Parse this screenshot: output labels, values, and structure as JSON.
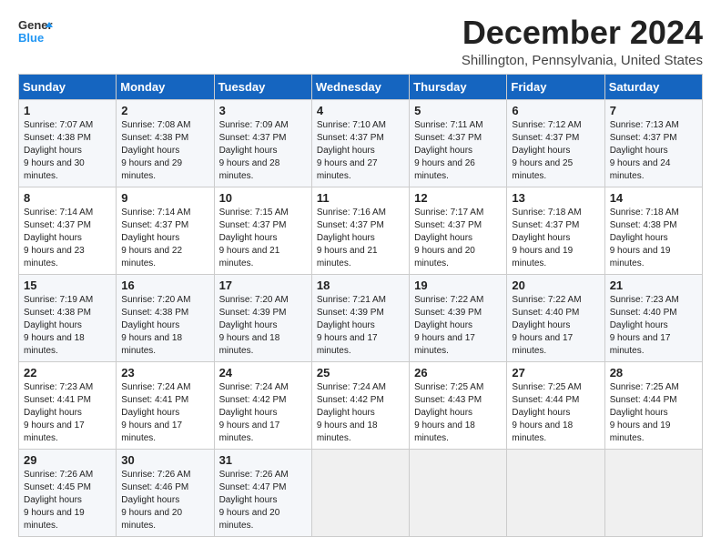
{
  "logo": {
    "line1": "General",
    "line2": "Blue"
  },
  "title": "December 2024",
  "location": "Shillington, Pennsylvania, United States",
  "headers": [
    "Sunday",
    "Monday",
    "Tuesday",
    "Wednesday",
    "Thursday",
    "Friday",
    "Saturday"
  ],
  "weeks": [
    [
      {
        "day": "1",
        "rise": "7:07 AM",
        "set": "4:38 PM",
        "daylight": "9 hours and 30 minutes."
      },
      {
        "day": "2",
        "rise": "7:08 AM",
        "set": "4:38 PM",
        "daylight": "9 hours and 29 minutes."
      },
      {
        "day": "3",
        "rise": "7:09 AM",
        "set": "4:37 PM",
        "daylight": "9 hours and 28 minutes."
      },
      {
        "day": "4",
        "rise": "7:10 AM",
        "set": "4:37 PM",
        "daylight": "9 hours and 27 minutes."
      },
      {
        "day": "5",
        "rise": "7:11 AM",
        "set": "4:37 PM",
        "daylight": "9 hours and 26 minutes."
      },
      {
        "day": "6",
        "rise": "7:12 AM",
        "set": "4:37 PM",
        "daylight": "9 hours and 25 minutes."
      },
      {
        "day": "7",
        "rise": "7:13 AM",
        "set": "4:37 PM",
        "daylight": "9 hours and 24 minutes."
      }
    ],
    [
      {
        "day": "8",
        "rise": "7:14 AM",
        "set": "4:37 PM",
        "daylight": "9 hours and 23 minutes."
      },
      {
        "day": "9",
        "rise": "7:14 AM",
        "set": "4:37 PM",
        "daylight": "9 hours and 22 minutes."
      },
      {
        "day": "10",
        "rise": "7:15 AM",
        "set": "4:37 PM",
        "daylight": "9 hours and 21 minutes."
      },
      {
        "day": "11",
        "rise": "7:16 AM",
        "set": "4:37 PM",
        "daylight": "9 hours and 21 minutes."
      },
      {
        "day": "12",
        "rise": "7:17 AM",
        "set": "4:37 PM",
        "daylight": "9 hours and 20 minutes."
      },
      {
        "day": "13",
        "rise": "7:18 AM",
        "set": "4:37 PM",
        "daylight": "9 hours and 19 minutes."
      },
      {
        "day": "14",
        "rise": "7:18 AM",
        "set": "4:38 PM",
        "daylight": "9 hours and 19 minutes."
      }
    ],
    [
      {
        "day": "15",
        "rise": "7:19 AM",
        "set": "4:38 PM",
        "daylight": "9 hours and 18 minutes."
      },
      {
        "day": "16",
        "rise": "7:20 AM",
        "set": "4:38 PM",
        "daylight": "9 hours and 18 minutes."
      },
      {
        "day": "17",
        "rise": "7:20 AM",
        "set": "4:39 PM",
        "daylight": "9 hours and 18 minutes."
      },
      {
        "day": "18",
        "rise": "7:21 AM",
        "set": "4:39 PM",
        "daylight": "9 hours and 17 minutes."
      },
      {
        "day": "19",
        "rise": "7:22 AM",
        "set": "4:39 PM",
        "daylight": "9 hours and 17 minutes."
      },
      {
        "day": "20",
        "rise": "7:22 AM",
        "set": "4:40 PM",
        "daylight": "9 hours and 17 minutes."
      },
      {
        "day": "21",
        "rise": "7:23 AM",
        "set": "4:40 PM",
        "daylight": "9 hours and 17 minutes."
      }
    ],
    [
      {
        "day": "22",
        "rise": "7:23 AM",
        "set": "4:41 PM",
        "daylight": "9 hours and 17 minutes."
      },
      {
        "day": "23",
        "rise": "7:24 AM",
        "set": "4:41 PM",
        "daylight": "9 hours and 17 minutes."
      },
      {
        "day": "24",
        "rise": "7:24 AM",
        "set": "4:42 PM",
        "daylight": "9 hours and 17 minutes."
      },
      {
        "day": "25",
        "rise": "7:24 AM",
        "set": "4:42 PM",
        "daylight": "9 hours and 18 minutes."
      },
      {
        "day": "26",
        "rise": "7:25 AM",
        "set": "4:43 PM",
        "daylight": "9 hours and 18 minutes."
      },
      {
        "day": "27",
        "rise": "7:25 AM",
        "set": "4:44 PM",
        "daylight": "9 hours and 18 minutes."
      },
      {
        "day": "28",
        "rise": "7:25 AM",
        "set": "4:44 PM",
        "daylight": "9 hours and 19 minutes."
      }
    ],
    [
      {
        "day": "29",
        "rise": "7:26 AM",
        "set": "4:45 PM",
        "daylight": "9 hours and 19 minutes."
      },
      {
        "day": "30",
        "rise": "7:26 AM",
        "set": "4:46 PM",
        "daylight": "9 hours and 20 minutes."
      },
      {
        "day": "31",
        "rise": "7:26 AM",
        "set": "4:47 PM",
        "daylight": "9 hours and 20 minutes."
      },
      null,
      null,
      null,
      null
    ]
  ],
  "labels": {
    "sunrise": "Sunrise:",
    "sunset": "Sunset:",
    "daylight": "Daylight hours"
  }
}
